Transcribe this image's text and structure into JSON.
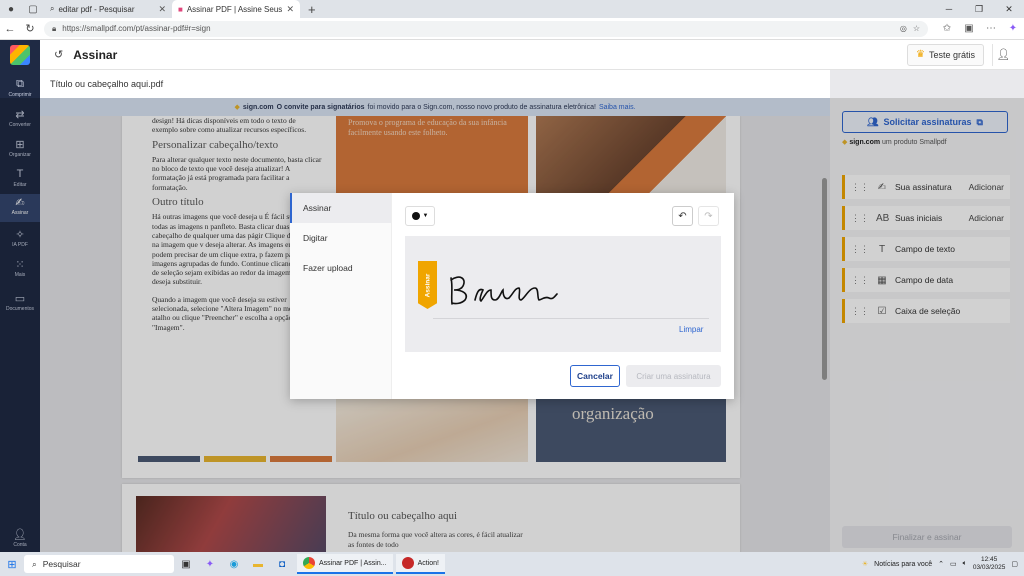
{
  "browser": {
    "tabs": [
      {
        "title": "editar pdf - Pesquisar",
        "icon": "search-icon",
        "active": false
      },
      {
        "title": "Assinar PDF | Assine Seus PDFs c",
        "icon": "smallpdf-icon",
        "active": true
      }
    ],
    "url": "https://smallpdf.com/pt/assinar-pdf#r=sign"
  },
  "header": {
    "title": "Assinar",
    "trial_label": "Teste grátis"
  },
  "sidebar": {
    "items": [
      {
        "label": "Comprimir",
        "icon": "compress-icon"
      },
      {
        "label": "Converter",
        "icon": "convert-icon"
      },
      {
        "label": "Organizar",
        "icon": "organize-icon"
      },
      {
        "label": "Editar",
        "icon": "edit-icon"
      },
      {
        "label": "Assinar",
        "icon": "sign-icon",
        "active": true
      },
      {
        "label": "IA PDF",
        "icon": "ai-icon"
      },
      {
        "label": "Mais",
        "icon": "more-icon"
      },
      {
        "label": "Documentos",
        "icon": "folder-icon"
      },
      {
        "label": "Conta",
        "icon": "account-icon"
      }
    ]
  },
  "file": {
    "name": "Título ou cabeçalho aqui.pdf"
  },
  "notice": {
    "brand": "sign.com",
    "strong": "O convite para signatários",
    "text": "foi movido para o Sign.com, nosso novo produto de assinatura eletrônica!",
    "link": "Saiba mais."
  },
  "document": {
    "p1_intro": "design! Há dicas disponíveis em todo o texto de exemplo sobre como atualizar recursos específicos.",
    "h1": "Personalizar cabeçalho/texto",
    "p1_body": "Para alterar qualquer texto neste documento, basta clicar no bloco de texto que você deseja atualizar! A formatação já está programada para facilitar a formatação.",
    "h2": "Outro título",
    "p2_body": "Há outras imagens que você deseja u É fácil substituir todas as imagens n panfleto. Basta clicar duas vezes no cabeçalho de qualquer uma das págir Clique duas vezes na imagem que v deseja alterar. As imagens em tela de podem precisar de um clique extra, p fazem parte das imagens agrupadas de fundo. Continue clicando até que de seleção sejam exibidas ao redor da imagem que você deseja substituir.",
    "p3_body": "Quando a imagem que você deseja su estiver selecionada, selecione \"Altera Imagem\" no menu de atalho ou clique \"Preencher\" e escolha a opção para \"Imagem\".",
    "orange_text": "Promova o programa de educação da sua infância facilmente usando este folheto.",
    "blue_text": "organização",
    "p2_title": "Título ou cabeçalho aqui",
    "p2_text": "Da mesma forma que você altera as cores, é fácil atualizar as fontes de todo"
  },
  "right_panel": {
    "request_label": "Solicitar assinaturas",
    "brand": "sign.com",
    "brand_suffix": "um produto Smallpdf",
    "fields": [
      {
        "label": "Sua assinatura",
        "icon": "signature-icon",
        "action": "Adicionar"
      },
      {
        "label": "Suas iniciais",
        "icon": "initials-icon",
        "action": "Adicionar"
      },
      {
        "label": "Campo de texto",
        "icon": "text-field-icon",
        "action": ""
      },
      {
        "label": "Campo de data",
        "icon": "calendar-icon",
        "action": ""
      },
      {
        "label": "Caixa de seleção",
        "icon": "checkbox-icon",
        "action": ""
      }
    ],
    "finish_label": "Finalizar e assinar"
  },
  "modal": {
    "tabs": [
      {
        "label": "Assinar",
        "active": true
      },
      {
        "label": "Digitar",
        "active": false
      },
      {
        "label": "Fazer upload",
        "active": false
      }
    ],
    "ink_color": "#111111",
    "tag_label": "Assinar",
    "clear_label": "Limpar",
    "cancel_label": "Cancelar",
    "create_label": "Criar uma assinatura"
  },
  "taskbar": {
    "search_placeholder": "Pesquisar",
    "apps": [
      {
        "label": "Assinar PDF | Assin...",
        "icon": "chrome-icon"
      },
      {
        "label": "Action!",
        "icon": "action-icon"
      }
    ],
    "news": "Notícias para você",
    "time": "12:45",
    "date": "03/03/2025"
  },
  "colors": {
    "accent": "#2f66d0",
    "brand_yellow": "#f0a500",
    "sidebar": "#1f2a44"
  }
}
